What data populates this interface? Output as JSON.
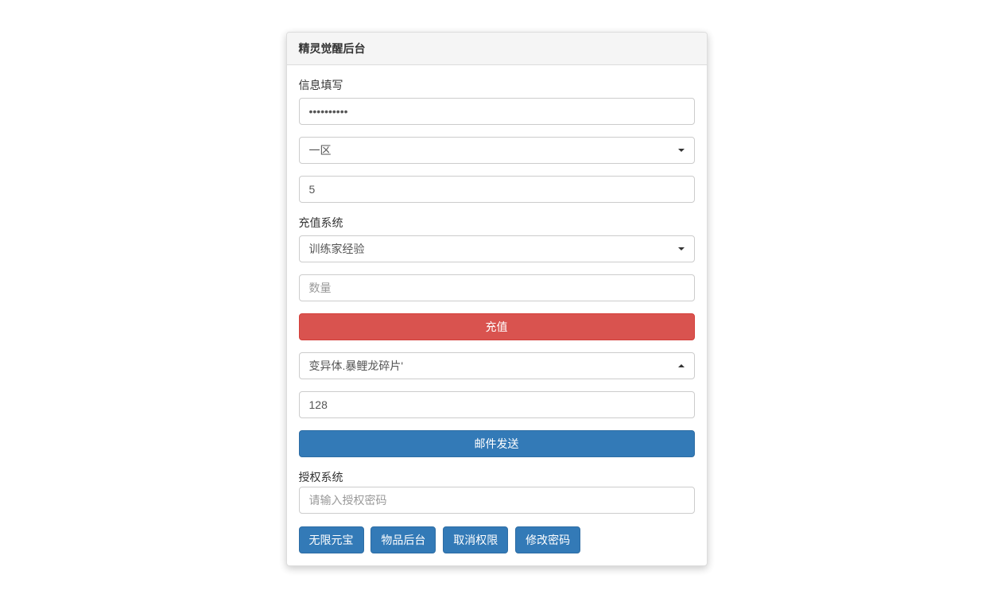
{
  "panel": {
    "title": "精灵觉醒后台"
  },
  "info": {
    "label": "信息填写",
    "password_value": "••••••••••",
    "zone_selected": "一区",
    "number_value": "5"
  },
  "recharge": {
    "label": "充值系统",
    "type_selected": "训练家经验",
    "amount_placeholder": "数量",
    "button_label": "充值"
  },
  "mail": {
    "item_selected": "变异体.暴鲤龙碎片'",
    "count_value": "128",
    "button_label": "邮件发送"
  },
  "auth": {
    "label": "授权系统",
    "placeholder": "请输入授权密码"
  },
  "buttons": {
    "unlimited": "无限元宝",
    "items_backend": "物品后台",
    "revoke": "取消权限",
    "change_pw": "修改密码"
  }
}
